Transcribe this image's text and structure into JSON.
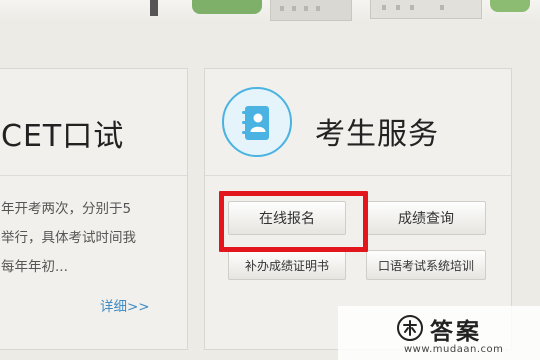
{
  "left_card": {
    "title": "CET口试",
    "desc_lines": [
      "年开考两次，分别于5",
      "举行，具体考试时间我",
      "每年年初..."
    ],
    "more_link": "详细>>"
  },
  "right_card": {
    "title": "考生服务",
    "icon": "address-book-icon",
    "buttons": {
      "register": "在线报名",
      "score_query": "成绩查询",
      "certificate": "补办成绩证明书",
      "oral_training": "口语考试系统培训"
    }
  },
  "watermark": {
    "title": "答案",
    "url": "www.mudaan.com"
  },
  "colors": {
    "accent": "#4ab3e2",
    "link": "#3f8cc6",
    "highlight": "#e3161e",
    "background": "#ecebe6"
  }
}
